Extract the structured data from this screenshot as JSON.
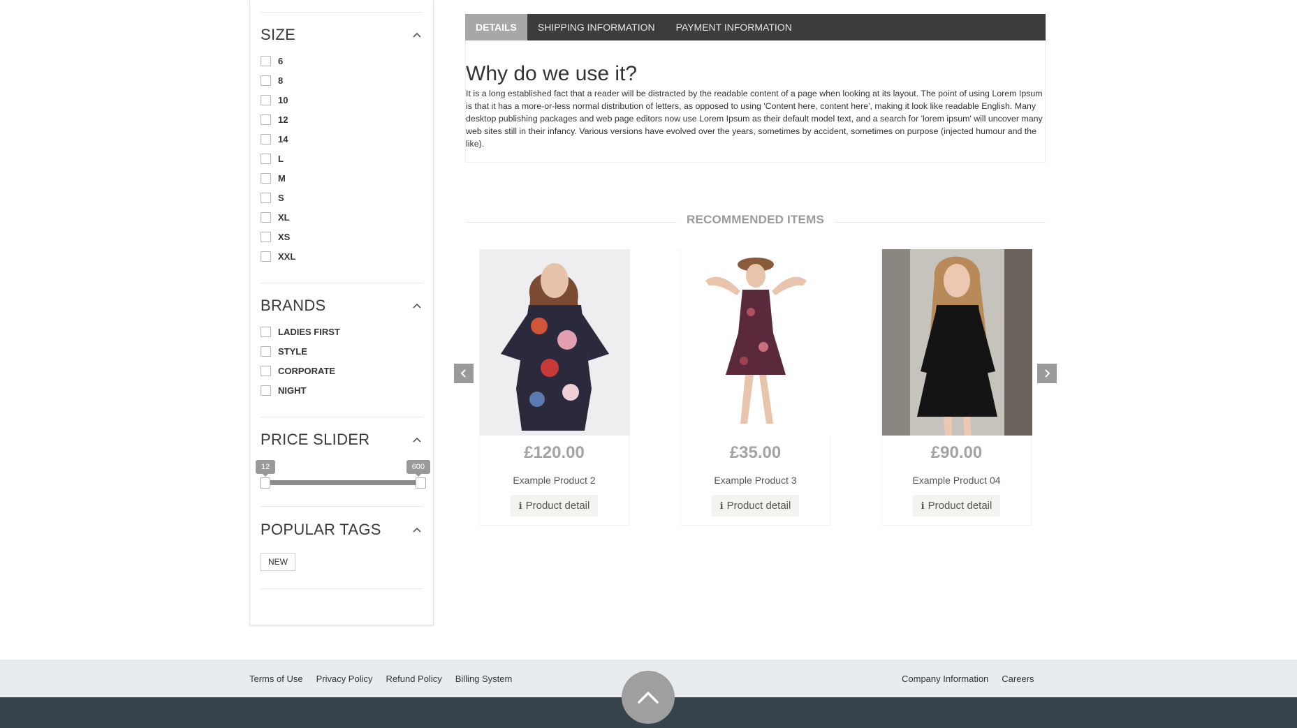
{
  "sidebar": {
    "size": {
      "title": "SIZE",
      "options": [
        "6",
        "8",
        "10",
        "12",
        "14",
        "L",
        "M",
        "S",
        "XL",
        "XS",
        "XXL"
      ]
    },
    "brands": {
      "title": "BRANDS",
      "options": [
        "LADIES FIRST",
        "STYLE",
        "CORPORATE",
        "NIGHT"
      ]
    },
    "price_slider": {
      "title": "PRICE SLIDER",
      "min_label": "12",
      "max_label": "600"
    },
    "popular_tags": {
      "title": "POPULAR TAGS",
      "tags": [
        "NEW"
      ]
    }
  },
  "tabs": {
    "items": [
      "DETAILS",
      "SHIPPING INFORMATION",
      "PAYMENT INFORMATION"
    ],
    "active": "DETAILS",
    "heading": "Why do we use it?",
    "body": "It is a long established fact that a reader will be distracted by the readable content of a page when looking at its layout. The point of using Lorem Ipsum is that it has a more-or-less normal distribution of letters, as opposed to using 'Content here, content here', making it look like readable English. Many desktop publishing packages and web page editors now use Lorem Ipsum as their default model text, and a search for 'lorem ipsum' will uncover many web sites still in their infancy. Various versions have evolved over the years, sometimes by accident, sometimes on purpose (injected humour and the like)."
  },
  "recommended": {
    "title": "RECOMMENDED ITEMS",
    "products": [
      {
        "price": "£120.00",
        "name": "Example Product 2",
        "button": "Product detail"
      },
      {
        "price": "£35.00",
        "name": "Example Product 3",
        "button": "Product detail"
      },
      {
        "price": "£90.00",
        "name": "Example Product 04",
        "button": "Product detail"
      }
    ]
  },
  "footer": {
    "left_links": [
      "Terms of Use",
      "Privacy Policy",
      "Refund Policy",
      "Billing System"
    ],
    "right_links": [
      "Company Information",
      "Careers"
    ]
  },
  "colors": {
    "tab_bar": "#3c3c3c",
    "tab_active": "#a7a7a7",
    "footer_light": "#e8ecef",
    "footer_dark": "#36434b",
    "price_text": "#a3a3a3"
  },
  "icons": {
    "section_toggle": "chevron-up-icon",
    "carousel_prev": "chevron-left-icon",
    "carousel_next": "chevron-right-icon",
    "product_button": "info-icon",
    "back_to_top": "chevron-up-icon"
  }
}
